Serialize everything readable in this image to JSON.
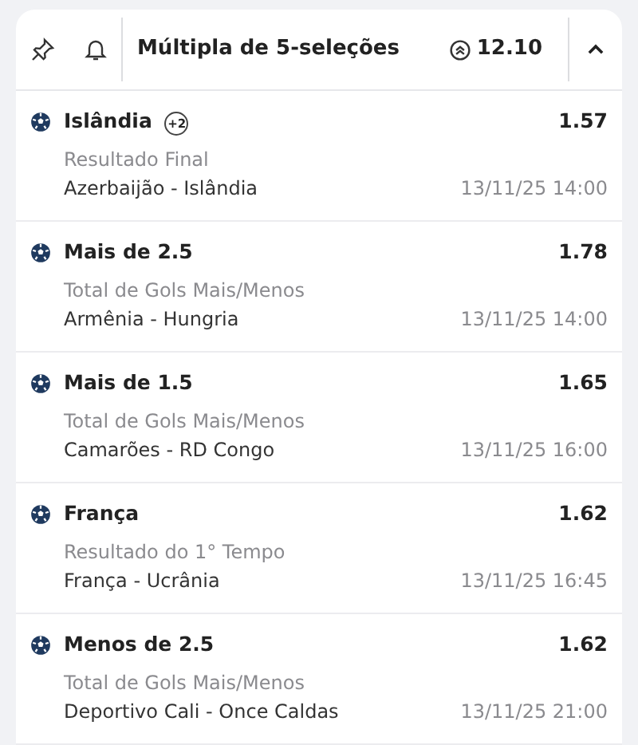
{
  "header": {
    "title": "Múltipla de 5-seleções",
    "total_odds": "12.10",
    "expanded": true
  },
  "selections": [
    {
      "pick": "Islândia",
      "extra": "+2",
      "odds": "1.57",
      "market": "Resultado Final",
      "match": "Azerbaijão - Islândia",
      "date": "13/11/25 14:00"
    },
    {
      "pick": "Mais de 2.5",
      "odds": "1.78",
      "market": "Total de Gols Mais/Menos",
      "match": "Armênia - Hungria",
      "date": "13/11/25 14:00"
    },
    {
      "pick": "Mais de 1.5",
      "odds": "1.65",
      "market": "Total de Gols Mais/Menos",
      "match": "Camarões - RD Congo",
      "date": "13/11/25 16:00"
    },
    {
      "pick": "França",
      "odds": "1.62",
      "market": "Resultado do 1° Tempo",
      "match": "França - Ucrânia",
      "date": "13/11/25 16:45"
    },
    {
      "pick": "Menos de 2.5",
      "odds": "1.62",
      "market": "Total de Gols Mais/Menos",
      "match": "Deportivo Cali - Once Caldas",
      "date": "13/11/25 21:00"
    }
  ]
}
